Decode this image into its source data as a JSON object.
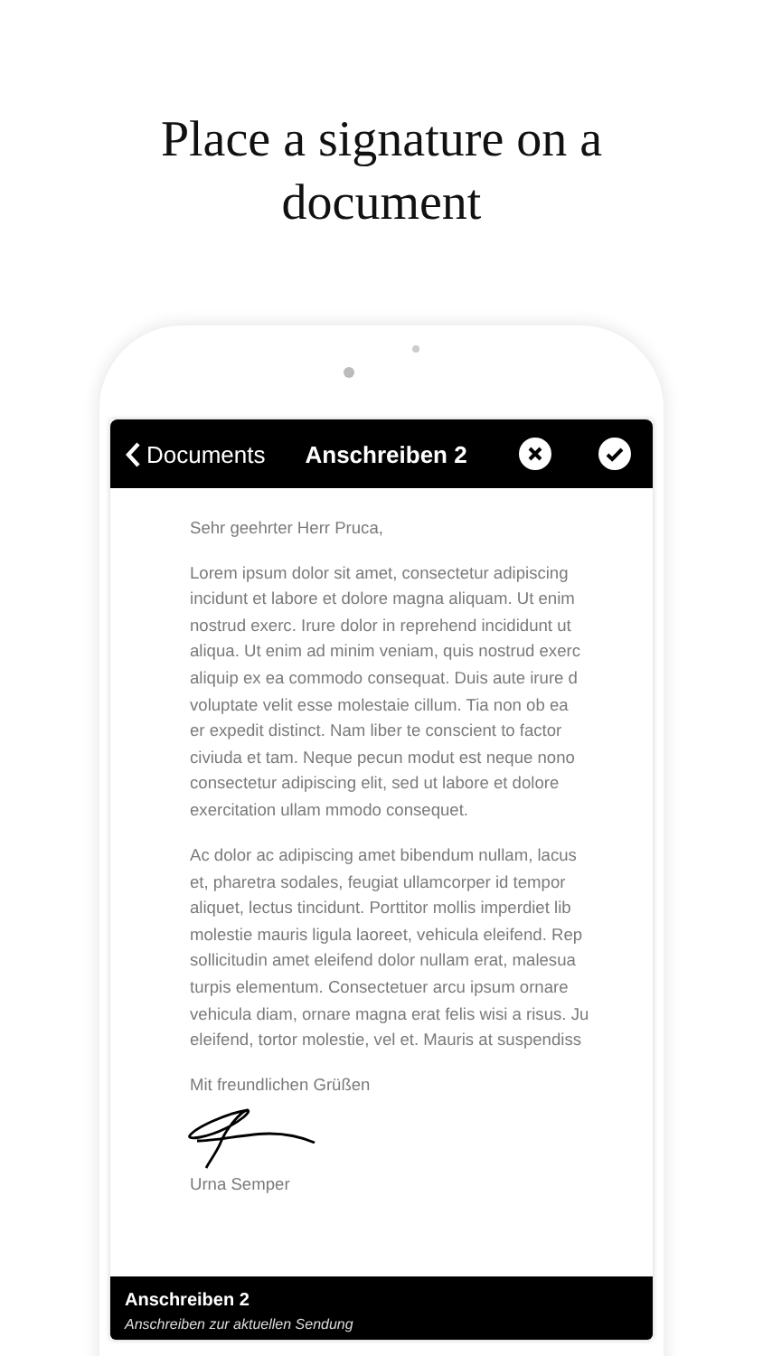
{
  "headline": "Place a signature on a document",
  "nav": {
    "back": "Documents",
    "title": "Anschreiben 2"
  },
  "document": {
    "salutation": "Sehr geehrter Herr Pruca,",
    "paragraphs": [
      [
        "Lorem ipsum dolor sit amet, consectetur adipiscing",
        "incidunt et labore et dolore magna aliquam. Ut enim",
        "nostrud exerc. Irure dolor in reprehend incididunt ut",
        "aliqua. Ut enim ad minim veniam, quis nostrud exerc",
        "aliquip ex ea commodo consequat. Duis aute irure d",
        "voluptate velit esse molestaie cillum. Tia non ob ea",
        "er expedit distinct. Nam liber te conscient to factor",
        "civiuda et tam. Neque pecun modut est neque nono",
        "consectetur adipiscing elit, sed ut labore et dolore",
        "exercitation ullam mmodo consequet."
      ],
      [
        "Ac dolor ac adipiscing amet bibendum nullam, lacus",
        "et, pharetra sodales, feugiat ullamcorper id tempor",
        "aliquet, lectus tincidunt. Porttitor mollis imperdiet lib",
        "molestie mauris ligula laoreet, vehicula eleifend. Rep",
        "sollicitudin amet eleifend dolor nullam erat, malesua",
        "turpis elementum. Consectetuer arcu ipsum ornare",
        "vehicula diam, ornare magna erat felis wisi a risus. Ju",
        "eleifend, tortor molestie, vel et. Mauris at suspendiss"
      ]
    ],
    "closing": "Mit freundlichen Grüßen",
    "signer": "Urna Semper"
  },
  "bottom_card": {
    "title": "Anschreiben 2",
    "subtitle": "Anschreiben zur aktuellen Sendung"
  }
}
